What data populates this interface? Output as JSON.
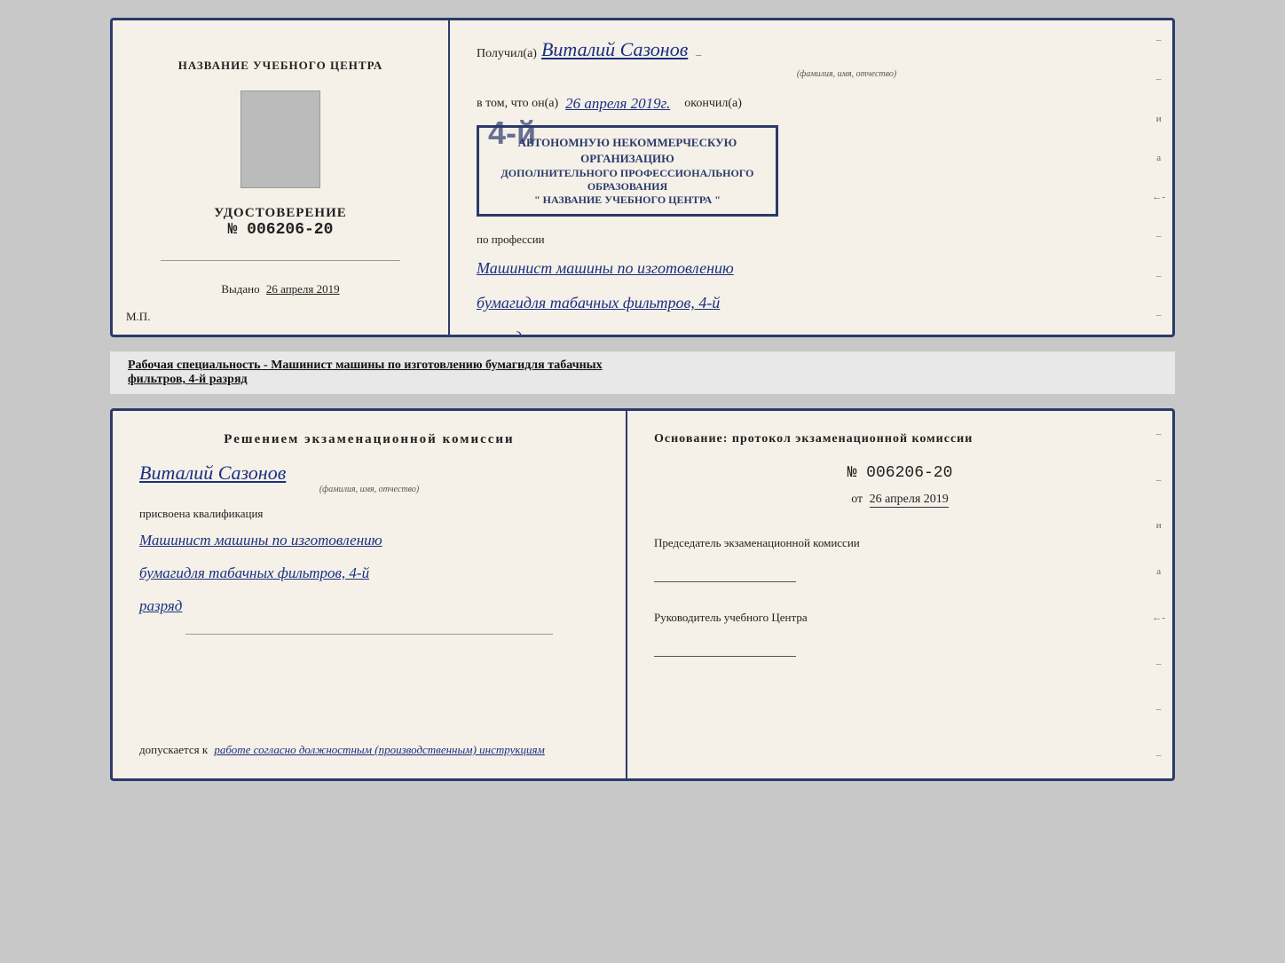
{
  "top_document": {
    "left": {
      "training_center_label": "НАЗВАНИЕ УЧЕБНОГО ЦЕНТРА",
      "udostoverenie_title": "УДОСТОВЕРЕНИЕ",
      "udostoverenie_number": "№ 006206-20",
      "vydano_label": "Выдано",
      "vydano_date": "26 апреля 2019",
      "mp_label": "М.П."
    },
    "right": {
      "poluchil_label": "Получил(а)",
      "recipient_name": "Виталий Сазонов",
      "fio_label": "(фамилия, имя, отчество)",
      "vtom_label": "в том, что он(а)",
      "date_label": "26 апреля 2019г.",
      "okonchil_label": "окончил(а)",
      "stamp_line1": "АВТОНОМНУЮ НЕКОММЕРЧЕСКУЮ ОРГАНИЗАЦИЮ",
      "stamp_line2": "ДОПОЛНИТЕЛЬНОГО ПРОФЕССИОНАЛЬНОГО ОБРАЗОВАНИЯ",
      "stamp_line3": "\" НАЗВАНИЕ УЧЕБНОГО ЦЕНТРА \"",
      "stamp_number": "4-й",
      "po_professii_label": "по профессии",
      "profession_line1": "Машинист машины по изготовлению",
      "profession_line2": "бумагидля табачных фильтров, 4-й",
      "profession_line3": "разряд"
    }
  },
  "middle_text": {
    "label": "Рабочая специальность - Машинист машины по изготовлению бумагидля табачных",
    "underline_part": "фильтров, 4-й разряд"
  },
  "bottom_document": {
    "left": {
      "komissia_title": "Решением  экзаменационной  комиссии",
      "fio_name": "Виталий Сазонов",
      "fio_label": "(фамилия, имя, отчество)",
      "присвоена_label": "присвоена квалификация",
      "profession_line1": "Машинист машины по изготовлению",
      "profession_line2": "бумагидля табачных фильтров, 4-й",
      "profession_line3": "разряд",
      "dopuskaetsya_label": "допускается к",
      "dopuskaetsya_value": "работе согласно должностным (производственным) инструкциям"
    },
    "right": {
      "osnovanie_label": "Основание: протокол экзаменационной  комиссии",
      "protocol_number": "№ 006206-20",
      "ot_label": "от",
      "ot_date": "26 апреля 2019",
      "predsedatel_label": "Председатель экзаменационной комиссии",
      "rukovoditel_label": "Руководитель учебного Центра"
    }
  }
}
